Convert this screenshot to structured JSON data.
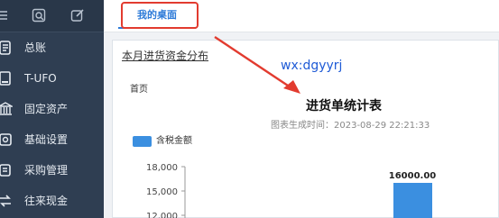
{
  "sidebar": {
    "top_icons": [
      "menu-icon",
      "image-icon",
      "edit-icon"
    ],
    "items": [
      {
        "label": "总账",
        "icon": "ledger-icon"
      },
      {
        "label": "T-UFO",
        "icon": "ufo-icon"
      },
      {
        "label": "固定资产",
        "icon": "bank-icon"
      },
      {
        "label": "基础设置",
        "icon": "settings-icon"
      },
      {
        "label": "采购管理",
        "icon": "purchase-icon"
      },
      {
        "label": "往来现金",
        "icon": "transfer-icon"
      }
    ]
  },
  "tabs": [
    {
      "label": "我的桌面",
      "active": true
    }
  ],
  "panel": {
    "title": "本月进货资金分布",
    "home_label": "首页",
    "watermark": "wx:dgyyrj"
  },
  "chart_data": {
    "type": "bar",
    "title": "进货单统计表",
    "subtitle": "图表生成时间：2023-08-29 22:21:33",
    "legend": [
      {
        "name": "含税金额",
        "color": "#3b8fe0"
      }
    ],
    "y_ticks": [
      "18,000",
      "15,000",
      "12,000"
    ],
    "ylim": [
      0,
      18000
    ],
    "series": [
      {
        "name": "含税金额",
        "values": [
          16000
        ]
      }
    ],
    "data_labels": [
      "16000.00"
    ]
  },
  "colors": {
    "sidebar_bg": "#2f3e52",
    "accent": "#2e7bd8",
    "annotation_red": "#e23b2f",
    "bar": "#3b8fe0"
  }
}
